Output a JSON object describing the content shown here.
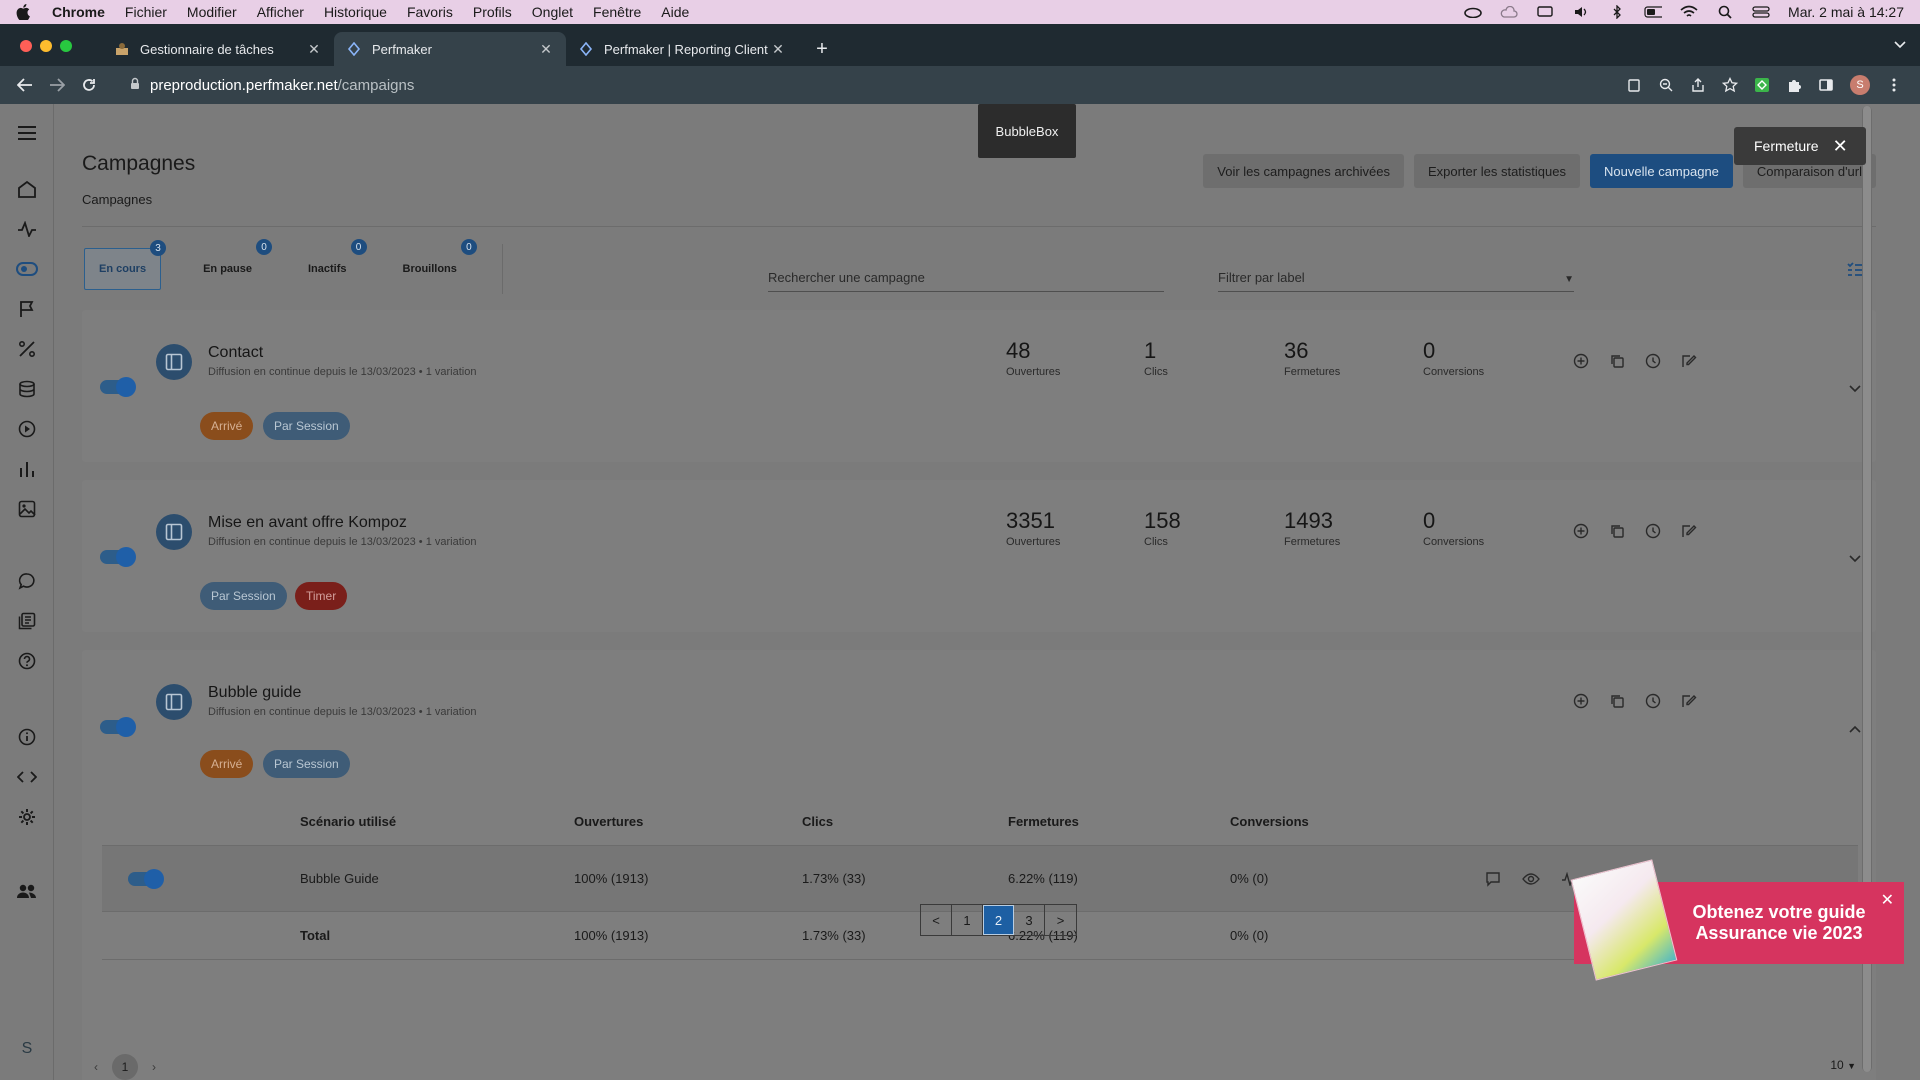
{
  "menubar": {
    "app": "Chrome",
    "items": [
      "Fichier",
      "Modifier",
      "Afficher",
      "Historique",
      "Favoris",
      "Profils",
      "Onglet",
      "Fenêtre",
      "Aide"
    ],
    "clock": "Mar. 2 mai à 14:27"
  },
  "browser": {
    "tabs": [
      {
        "title": "Gestionnaire de tâches"
      },
      {
        "title": "Perfmaker"
      },
      {
        "title": "Perfmaker | Reporting Client | S"
      }
    ],
    "url_host": "preproduction.perfmaker.net",
    "url_path": "/campaigns",
    "profile_initial": "S"
  },
  "page": {
    "title": "Campagnes",
    "breadcrumb": "Campagnes",
    "actions": {
      "archived": "Voir les campagnes archivées",
      "export": "Exporter les statistiques",
      "new": "Nouvelle campagne",
      "compare": "Comparaison d'url"
    },
    "status_tabs": [
      {
        "label": "En cours",
        "count": "3"
      },
      {
        "label": "En pause",
        "count": "0"
      },
      {
        "label": "Inactifs",
        "count": "0"
      },
      {
        "label": "Brouillons",
        "count": "0"
      }
    ],
    "search_placeholder": "Rechercher une campagne",
    "filter_placeholder": "Filtrer par label"
  },
  "stat_labels": {
    "opens": "Ouvertures",
    "clicks": "Clics",
    "closes": "Fermetures",
    "conversions": "Conversions"
  },
  "campaigns": [
    {
      "name": "Contact",
      "subtitle": "Diffusion en continue depuis le 13/03/2023 • 1 variation",
      "opens": "48",
      "clicks": "1",
      "closes": "36",
      "conversions": "0",
      "chips": [
        "Arrivé",
        "Par Session"
      ]
    },
    {
      "name": "Mise en avant offre Kompoz",
      "subtitle": "Diffusion en continue depuis le 13/03/2023 • 1 variation",
      "opens": "3351",
      "clicks": "158",
      "closes": "1493",
      "conversions": "0",
      "chips": [
        "Par Session",
        "Timer"
      ]
    },
    {
      "name": "Bubble guide",
      "subtitle": "Diffusion en continue depuis le 13/03/2023 • 1 variation",
      "chips": [
        "Arrivé",
        "Par Session"
      ]
    }
  ],
  "variation_table": {
    "headers": [
      "Scénario utilisé",
      "Ouvertures",
      "Clics",
      "Fermetures",
      "Conversions"
    ],
    "row": {
      "scenario": "Bubble Guide",
      "opens": "100% (1913)",
      "clicks": "1.73% (33)",
      "closes": "6.22% (119)",
      "conversions": "0% (0)"
    },
    "total": {
      "label": "Total",
      "opens": "100% (1913)",
      "clicks": "1.73% (33)",
      "closes": "6.22% (119)",
      "conversions": "0% (0)"
    }
  },
  "pagination": {
    "prev": "<",
    "pages": [
      "1",
      "2",
      "3"
    ],
    "current": "2",
    "next": ">"
  },
  "bottom_pager": {
    "current": "1",
    "per_page": "10"
  },
  "overlays": {
    "tooltip": "BubbleBox",
    "close_label": "Fermeture",
    "promo_text": "Obtenez votre guide Assurance vie 2023"
  },
  "sidebar_user_initial": "S",
  "colors": {
    "accent": "#1d4d80",
    "promo": "#d6345f",
    "chip_orange": "#8a4d1c",
    "chip_red": "#7a1f1a"
  }
}
